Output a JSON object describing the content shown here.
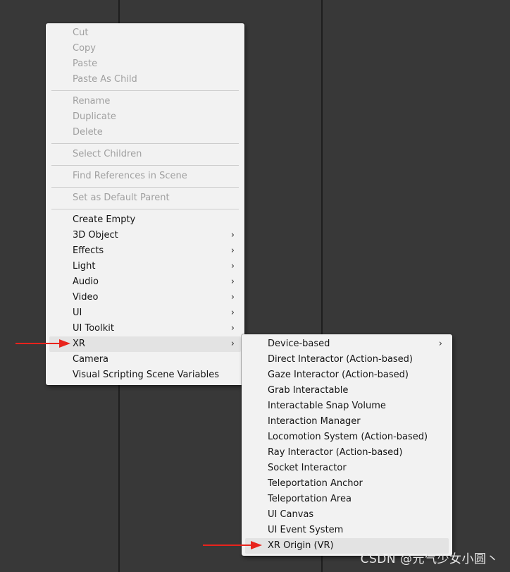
{
  "context_menu": {
    "groups": [
      [
        {
          "label": "Cut",
          "enabled": false
        },
        {
          "label": "Copy",
          "enabled": false
        },
        {
          "label": "Paste",
          "enabled": false
        },
        {
          "label": "Paste As Child",
          "enabled": false
        }
      ],
      [
        {
          "label": "Rename",
          "enabled": false
        },
        {
          "label": "Duplicate",
          "enabled": false
        },
        {
          "label": "Delete",
          "enabled": false
        }
      ],
      [
        {
          "label": "Select Children",
          "enabled": false
        }
      ],
      [
        {
          "label": "Find References in Scene",
          "enabled": false
        }
      ],
      [
        {
          "label": "Set as Default Parent",
          "enabled": false
        }
      ],
      [
        {
          "label": "Create Empty",
          "enabled": true
        },
        {
          "label": "3D Object",
          "enabled": true,
          "submenu": true
        },
        {
          "label": "Effects",
          "enabled": true,
          "submenu": true
        },
        {
          "label": "Light",
          "enabled": true,
          "submenu": true
        },
        {
          "label": "Audio",
          "enabled": true,
          "submenu": true
        },
        {
          "label": "Video",
          "enabled": true,
          "submenu": true
        },
        {
          "label": "UI",
          "enabled": true,
          "submenu": true
        },
        {
          "label": "UI Toolkit",
          "enabled": true,
          "submenu": true
        },
        {
          "label": "XR",
          "enabled": true,
          "submenu": true,
          "highlighted": true
        },
        {
          "label": "Camera",
          "enabled": true
        },
        {
          "label": "Visual Scripting Scene Variables",
          "enabled": true
        }
      ]
    ]
  },
  "xr_submenu": {
    "items": [
      {
        "label": "Device-based",
        "submenu": true
      },
      {
        "label": "Direct Interactor (Action-based)"
      },
      {
        "label": "Gaze Interactor (Action-based)"
      },
      {
        "label": "Grab Interactable"
      },
      {
        "label": "Interactable Snap Volume"
      },
      {
        "label": "Interaction Manager"
      },
      {
        "label": "Locomotion System (Action-based)"
      },
      {
        "label": "Ray Interactor (Action-based)"
      },
      {
        "label": "Socket Interactor"
      },
      {
        "label": "Teleportation Anchor"
      },
      {
        "label": "Teleportation Area"
      },
      {
        "label": "UI Canvas"
      },
      {
        "label": "UI Event System"
      },
      {
        "label": "XR Origin (VR)",
        "highlighted": true
      }
    ]
  },
  "icons": {
    "submenu_chevron": "chevron-right-icon",
    "chevron_glyph": "›",
    "annotation_arrow": "red-arrow-icon"
  },
  "colors": {
    "background": "#383838",
    "menu_bg": "#f2f2f2",
    "highlight": "#e3e3e3",
    "disabled_text": "#a0a0a0",
    "arrow": "#e8231c"
  },
  "watermark": {
    "text": "CSDN @元气少女小圆丶"
  }
}
